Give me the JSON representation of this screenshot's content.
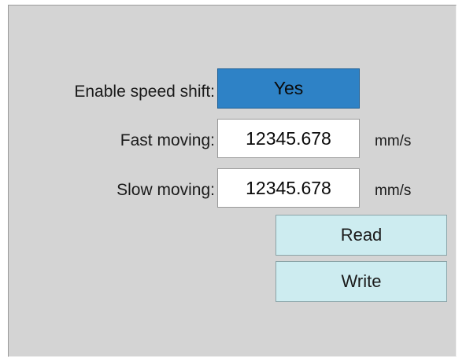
{
  "speed_shift": {
    "label": "Enable speed shift:",
    "value": "Yes"
  },
  "fast_moving": {
    "label": "Fast moving:",
    "value": "12345.678",
    "unit": "mm/s"
  },
  "slow_moving": {
    "label": "Slow moving:",
    "value": "12345.678",
    "unit": "mm/s"
  },
  "actions": {
    "read_label": "Read",
    "write_label": "Write"
  },
  "colors": {
    "panel_bg": "#d4d4d4",
    "toggle_active": "#2e82c6",
    "action_button_bg": "#cdecf0"
  }
}
